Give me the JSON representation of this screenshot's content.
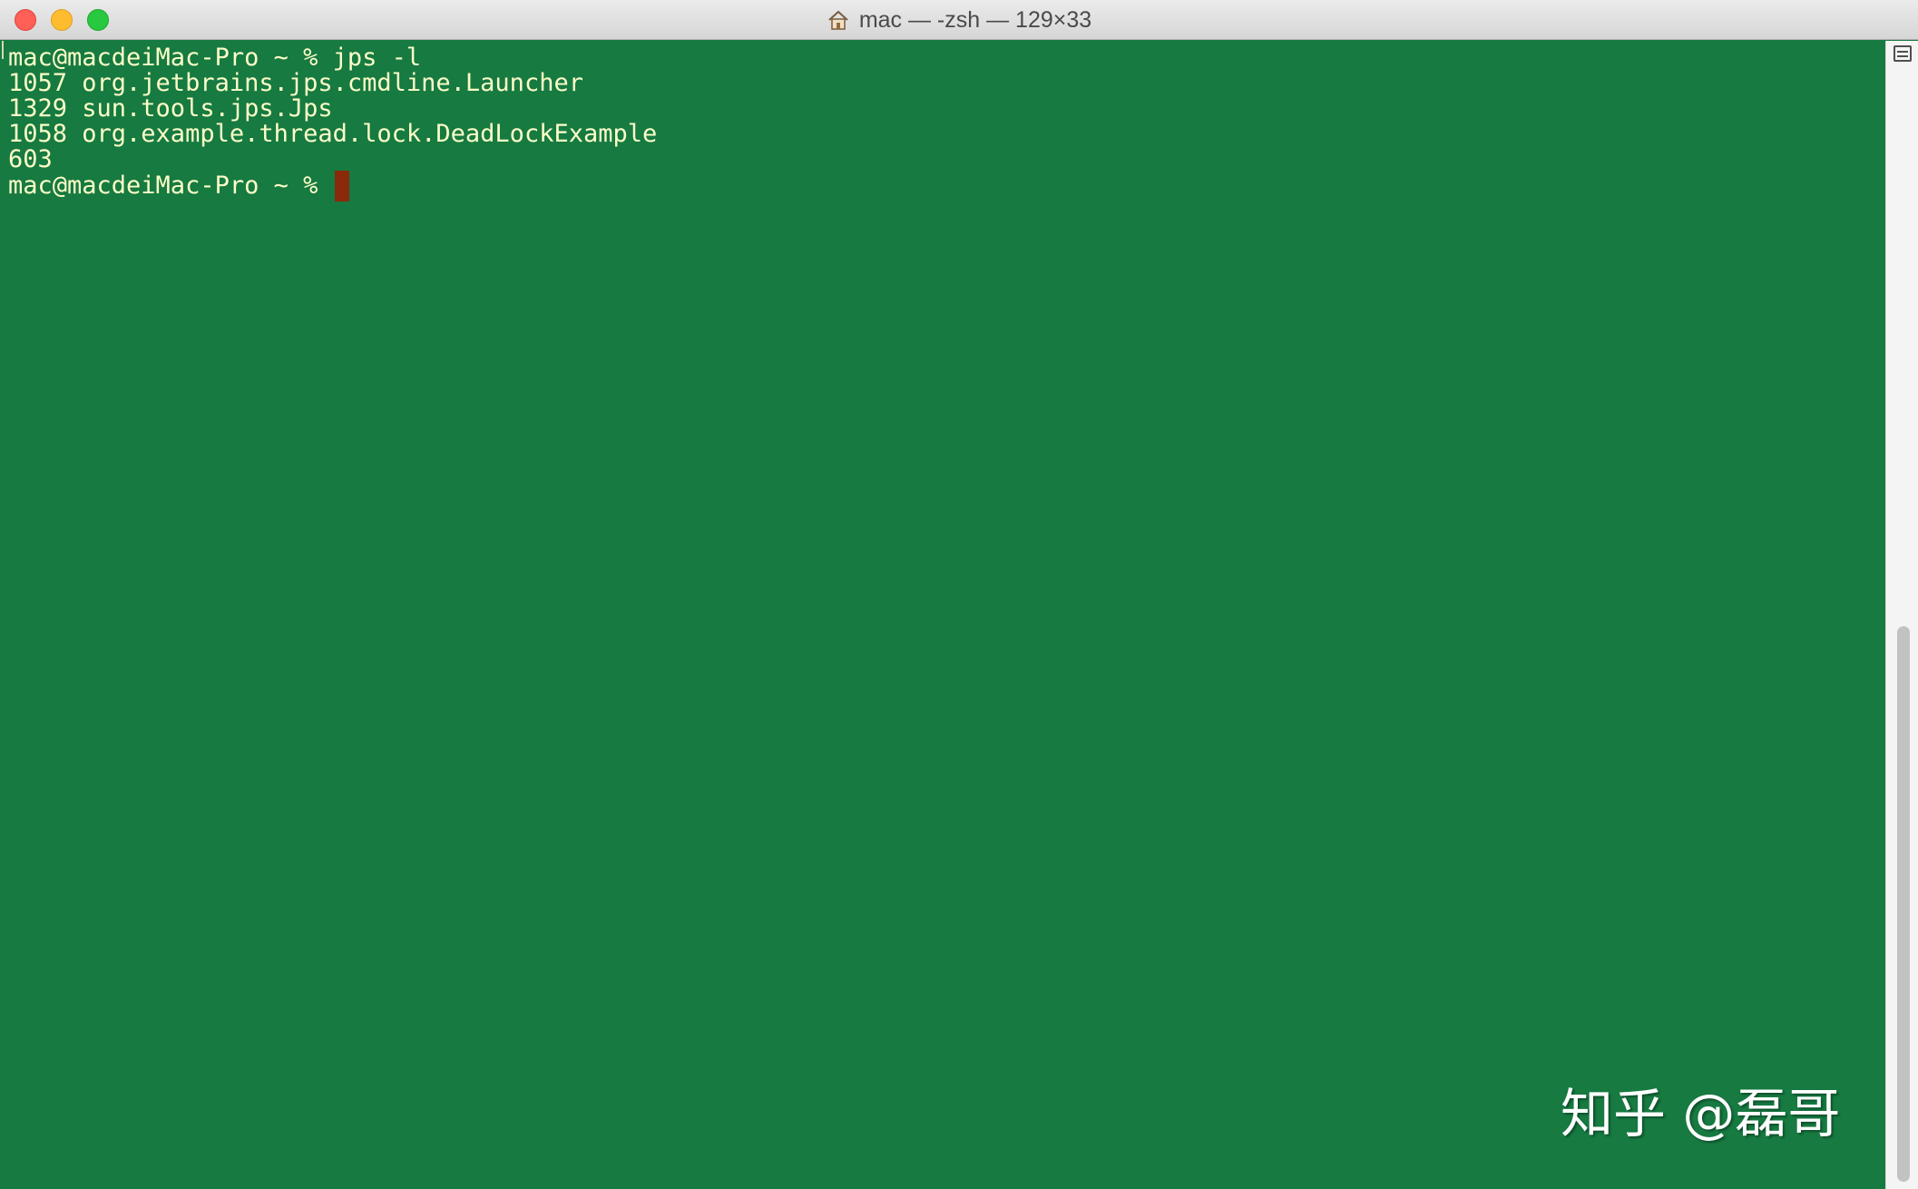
{
  "window": {
    "title": "mac — -zsh — 129×33",
    "title_icon": "home-icon"
  },
  "terminal": {
    "background_color": "#167a41",
    "text_color": "#fdfdc8",
    "cursor_color": "#8a2a0a",
    "lines": [
      "mac@macdeiMac-Pro ~ % jps -l",
      "1057 org.jetbrains.jps.cmdline.Launcher",
      "1329 sun.tools.jps.Jps",
      "1058 org.example.thread.lock.DeadLockExample",
      "603",
      "mac@macdeiMac-Pro ~ % "
    ]
  },
  "watermark": {
    "text": "知乎 @磊哥"
  }
}
